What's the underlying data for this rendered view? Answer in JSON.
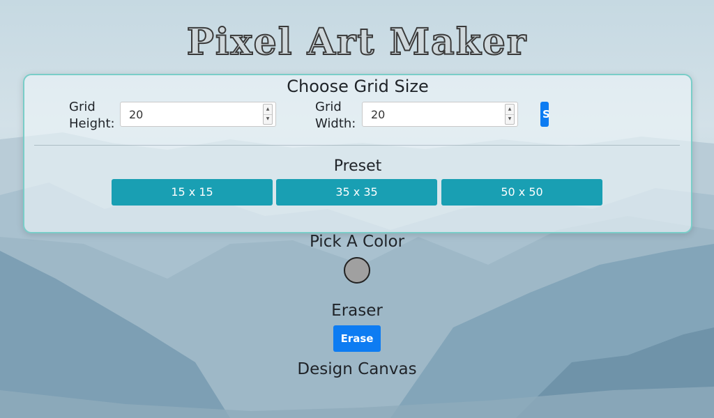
{
  "app": {
    "title": "Pixel Art Maker"
  },
  "grid_panel": {
    "heading": "Choose Grid Size",
    "height_label_line1": "Grid",
    "height_label_line2": "Height:",
    "height_value": "20",
    "width_label_line1": "Grid",
    "width_label_line2": "Width:",
    "width_value": "20",
    "submit_label": "S"
  },
  "preset": {
    "heading": "Preset",
    "buttons": [
      "15 x 15",
      "35 x 35",
      "50 x 50"
    ]
  },
  "color": {
    "heading": "Pick A Color",
    "value": "#a0a0a0"
  },
  "eraser": {
    "heading": "Eraser",
    "button_label": "Erase"
  },
  "canvas": {
    "heading": "Design Canvas"
  },
  "colors": {
    "accent_blue": "#0d7cf2",
    "preset_teal": "#199fb3",
    "panel_border": "#79cdc8"
  }
}
